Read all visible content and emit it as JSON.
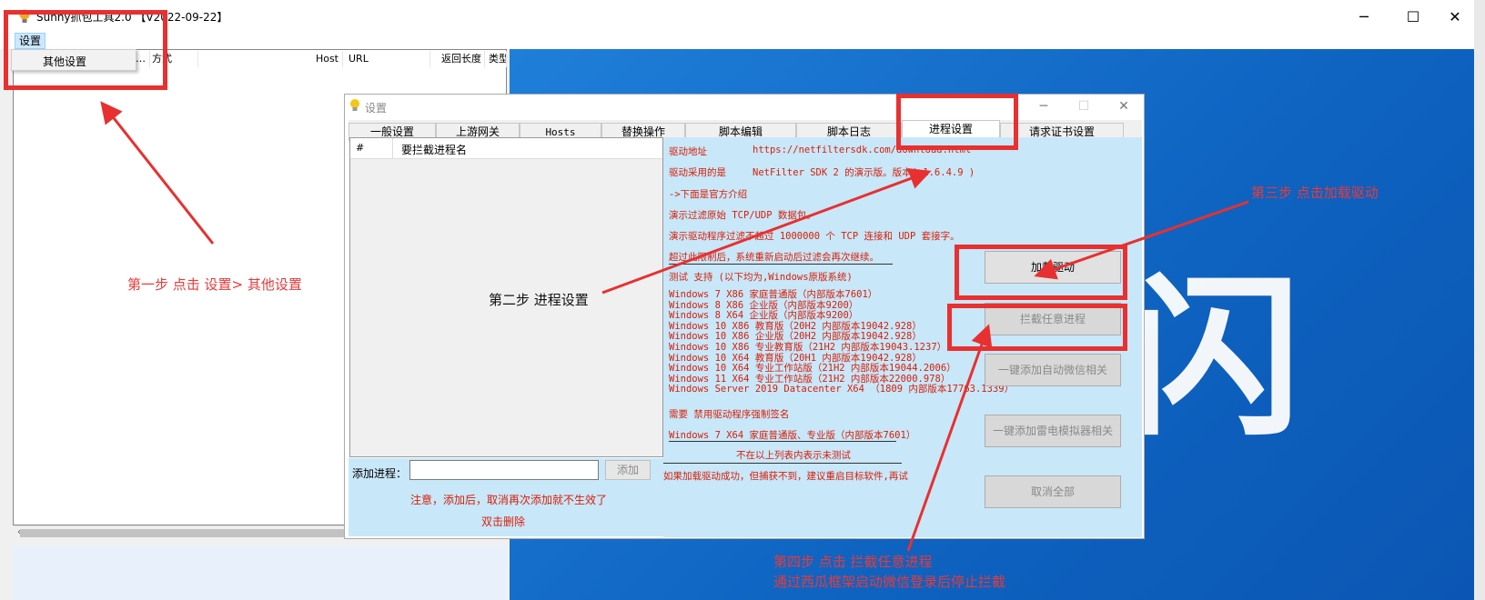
{
  "window": {
    "title": "Sunny抓包工具2.0 【V2022-09-22】",
    "controls": {
      "minimize": "─",
      "maximize": "☐",
      "close": "✕"
    }
  },
  "menu": {
    "settings_label": "设置",
    "dropdown_item": "其他设置"
  },
  "list": {
    "columns": [
      "…",
      "方式",
      "Host",
      "URL",
      "返回长度",
      "类型"
    ]
  },
  "big_glyph": "闪",
  "dialog": {
    "title": "设置",
    "tabs": [
      "一般设置",
      "上游网关",
      "Hosts",
      "替换操作",
      "脚本编辑",
      "脚本日志",
      "进程设置",
      "请求证书设置"
    ],
    "selected_tab": "进程设置",
    "process_table": {
      "columns": [
        "#",
        "要拦截进程名"
      ]
    },
    "add_process_label": "添加进程：",
    "add_process_value": "",
    "add_button": "添加",
    "note_line1": "注意，添加后，取消再次添加就不生效了",
    "note_line2": "双击删除",
    "driver_info": {
      "addr_label": "驱动地址",
      "addr_url": "https://netfiltersdk.com/download.html",
      "used_label": "驱动采用的是",
      "used_value": "NetFilter SDK 2 的演示版。版本( 1.6.4.9 )",
      "intro_line": "->下面是官方介绍",
      "desc1": "演示过滤原始 TCP/UDP 数据包。",
      "desc2": "演示驱动程序过滤不超过 1000000 个 TCP 连接和 UDP 套接字。",
      "desc3": "超过此限制后，系统重新启动后过滤会再次继续。",
      "test_line": "测试 支持 (以下均为,Windows原版系统)",
      "versions": [
        "Windows 7 X86 家庭普通版（内部版本7601）",
        "Windows 8 X86 企业版（内部版本9200）",
        "Windows 8 X64 企业版（内部版本9200）",
        "Windows 10 X86 教育版（20H2 内部版本19042.928）",
        "Windows 10 X86 企业版（20H2 内部版本19042.928）",
        "Windows 10 X86 专业教育版（21H2 内部版本19043.1237）",
        "Windows 10 X64 教育版（20H1 内部版本19042.928）",
        "Windows 10 X64 专业工作站版（21H2 内部版本19044.2006）",
        "Windows 11 X64 专业工作站版（21H2 内部版本22000.978）",
        "Windows Server 2019 Datacenter X64 （1809 内部版本17763.1339）"
      ],
      "need_line": "需要 禁用驱动程序强制签名",
      "win7x64_line": "Windows 7 X64 家庭普通版、专业版（内部版本7601）",
      "untested_line": "不在以上列表内表示未测试",
      "retry_line": "如果加载驱动成功，但捕获不到，建议重启目标软件,再试"
    },
    "buttons": {
      "load_driver": "加载驱动",
      "intercept_any": "拦截任意进程",
      "add_wechat": "一键添加自动微信相关",
      "add_leidian": "一键添加雷电模拟器相关",
      "cancel_all": "取消全部"
    }
  },
  "annotations": {
    "step1": "第一步 点击 设置> 其他设置",
    "step2": "第二步 进程设置",
    "step3": "第三步 点击加载驱动",
    "step4_line1": "第四步 点击 拦截任意进程",
    "step4_line2": "通过西瓜框架启动微信登录后停止拦截"
  },
  "colors": {
    "annotation_red": "#e83030",
    "info_text_red": "#d81e06",
    "info_panel_bg": "#c8e7f9",
    "desktop_blue": "#0e62c0"
  }
}
